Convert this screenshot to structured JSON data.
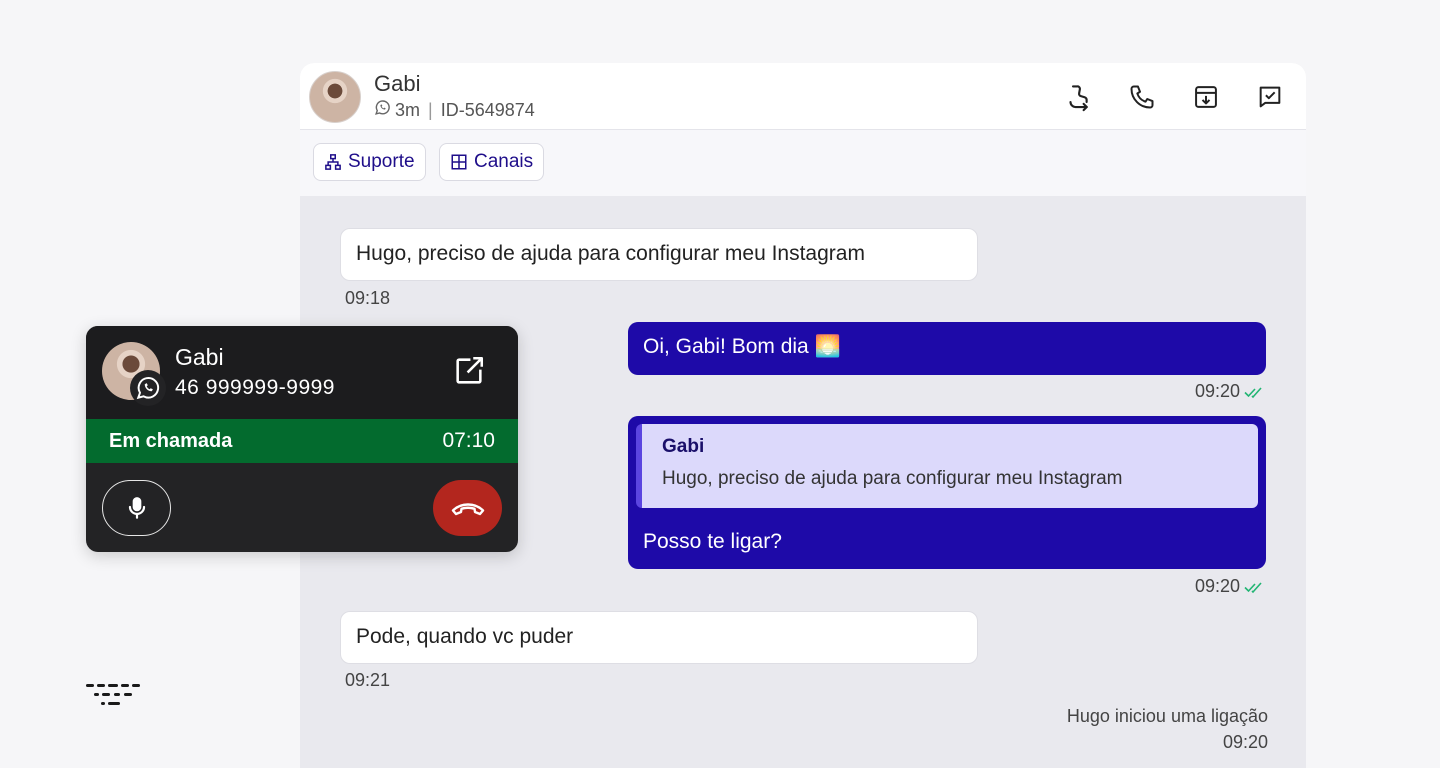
{
  "header": {
    "contact_name": "Gabi",
    "time_ago": "3m",
    "ticket_id": "ID-5649874",
    "actions": [
      {
        "icon": "transfer-icon"
      },
      {
        "icon": "phone-icon"
      },
      {
        "icon": "archive-icon"
      },
      {
        "icon": "resolve-icon"
      }
    ]
  },
  "tags": [
    {
      "label": "Suporte",
      "icon": "sitemap-icon"
    },
    {
      "label": "Canais",
      "icon": "grid-icon"
    }
  ],
  "messages": {
    "m1": {
      "text": "Hugo, preciso de ajuda para configurar meu Instagram",
      "time": "09:18"
    },
    "m2": {
      "text": "Oi, Gabi! Bom dia 🌅",
      "time": "09:20"
    },
    "m3": {
      "quote_author": "Gabi",
      "quote_text": "Hugo, preciso de ajuda para configurar meu Instagram",
      "text": "Posso te ligar?",
      "time": "09:20"
    },
    "m4": {
      "text": "Pode, quando vc puder",
      "time": "09:21"
    },
    "system": {
      "text": "Hugo iniciou uma ligação",
      "time": "09:20"
    }
  },
  "call": {
    "name": "Gabi",
    "phone": "46 999999-9999",
    "status": "Em chamada",
    "duration": "07:10"
  },
  "colors": {
    "outgoing_bubble": "#1e0aa8",
    "call_active": "#036b2e",
    "hangup": "#b3261e",
    "read_check": "#22b573"
  }
}
